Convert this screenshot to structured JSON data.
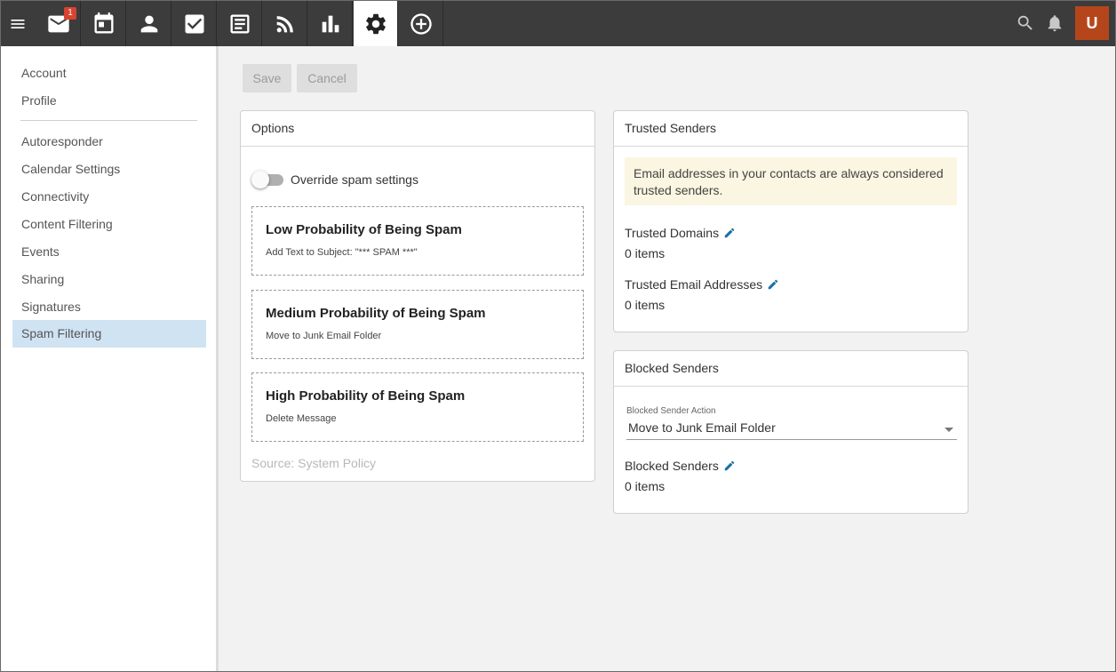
{
  "nav": {
    "mail_badge": "1",
    "avatar_letter": "U"
  },
  "sidebar": {
    "items": [
      {
        "label": "Account"
      },
      {
        "label": "Profile"
      },
      {
        "label": "Autoresponder"
      },
      {
        "label": "Calendar Settings"
      },
      {
        "label": "Connectivity"
      },
      {
        "label": "Content Filtering"
      },
      {
        "label": "Events"
      },
      {
        "label": "Sharing"
      },
      {
        "label": "Signatures"
      },
      {
        "label": "Spam Filtering"
      }
    ],
    "active_item": "Spam Filtering"
  },
  "toolbar": {
    "save_label": "Save",
    "cancel_label": "Cancel"
  },
  "options": {
    "title": "Options",
    "override_label": "Override spam settings",
    "override_enabled": false,
    "levels": [
      {
        "title": "Low Probability of Being Spam",
        "action": "Add Text to Subject: \"*** SPAM ***\""
      },
      {
        "title": "Medium Probability of Being Spam",
        "action": "Move to Junk Email Folder"
      },
      {
        "title": "High Probability of Being Spam",
        "action": "Delete Message"
      }
    ],
    "source": "Source: System Policy"
  },
  "trusted": {
    "title": "Trusted Senders",
    "note": "Email addresses in your contacts are always considered trusted senders.",
    "domains_label": "Trusted Domains",
    "domains_count": "0 items",
    "emails_label": "Trusted Email Addresses",
    "emails_count": "0 items"
  },
  "blocked": {
    "title": "Blocked Senders",
    "action_label": "Blocked Sender Action",
    "action_value": "Move to Junk Email Folder",
    "senders_label": "Blocked Senders",
    "senders_count": "0 items"
  },
  "colors": {
    "topbar": "#3c3c3c",
    "active_sidebar": "#cfe3f3",
    "avatar": "#b5461c",
    "badge": "#d9432f",
    "accent_pencil": "#1a6fa3",
    "note_bg": "#faf6e1"
  },
  "icons": [
    "menu-icon",
    "mail-icon",
    "calendar-icon",
    "contacts-icon",
    "tasks-icon",
    "notes-icon",
    "rss-icon",
    "reports-icon",
    "settings-icon",
    "add-icon",
    "search-icon",
    "bell-icon",
    "pencil-icon"
  ]
}
